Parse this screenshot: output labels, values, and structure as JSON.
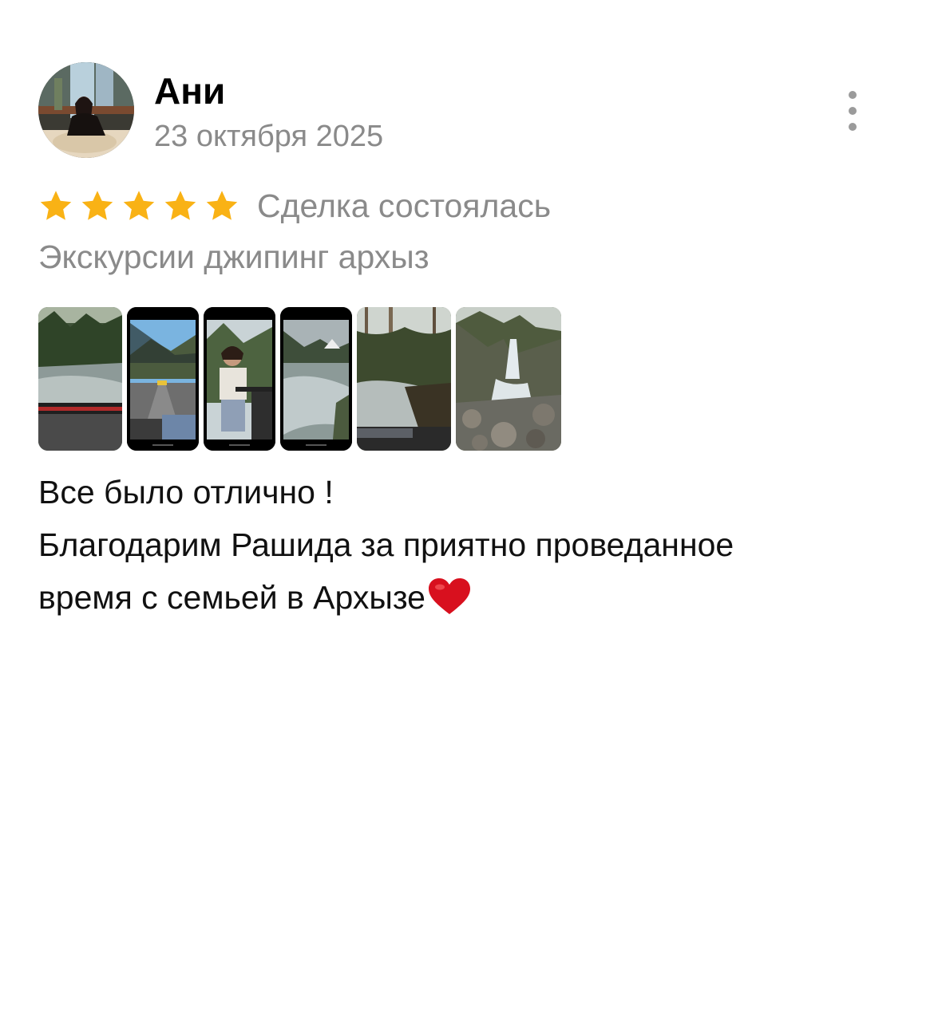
{
  "review": {
    "author_name": "Ани",
    "date": "23 октября 2025",
    "rating": 5,
    "rating_max": 5,
    "deal_status": "Сделка состоялась",
    "service_name": "Экскурсии джипинг архыз",
    "text_lines": [
      "Все было отлично !",
      "Благодарим Рашида за приятно проведанное",
      "время с семьей в Архызе"
    ],
    "emoji": "heart-icon",
    "photos_count": 6
  },
  "colors": {
    "star": "#F9B215",
    "secondary_text": "#8A8A8A",
    "heart": "#D8101E"
  }
}
